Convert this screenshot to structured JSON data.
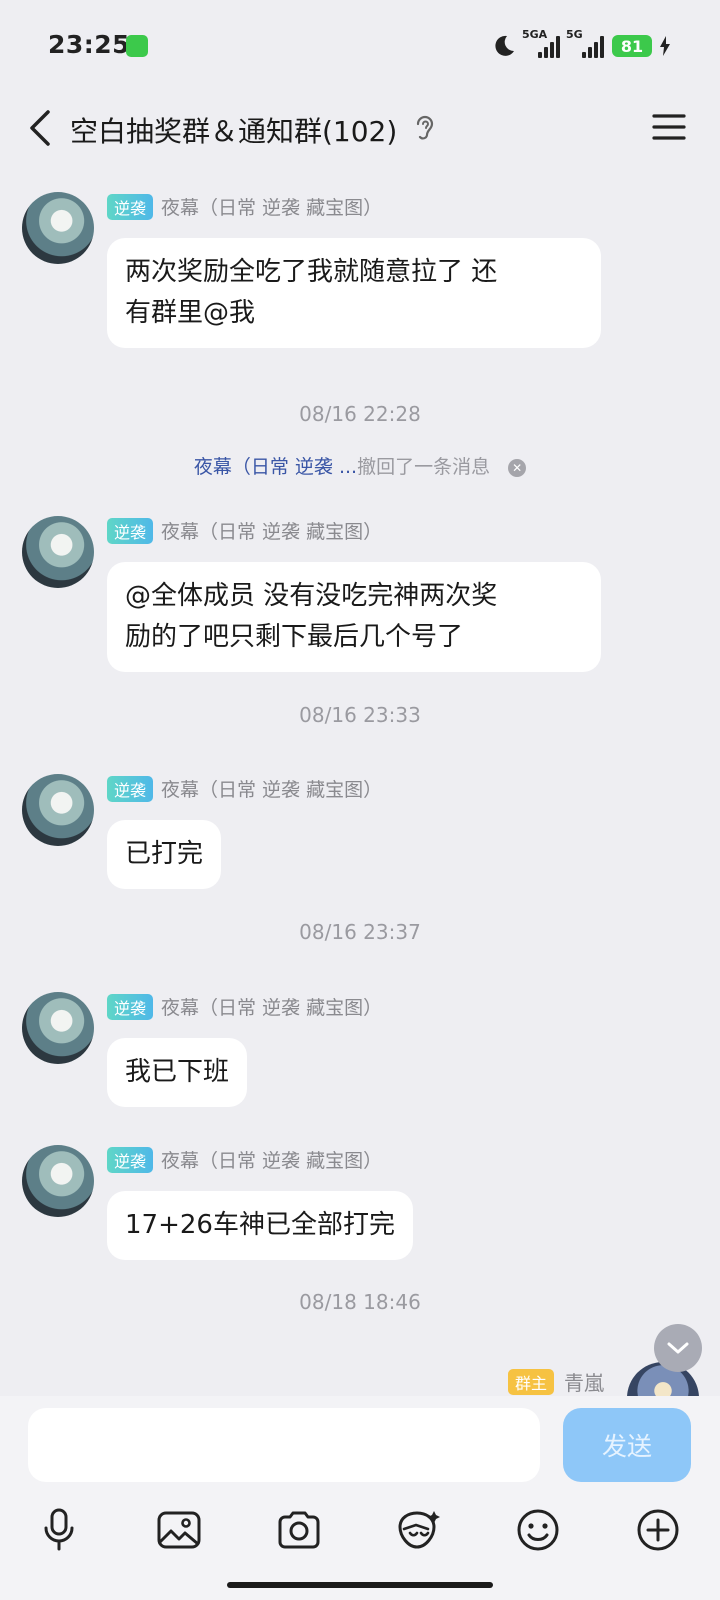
{
  "status_bar": {
    "time": "23:25",
    "network1": "5GA",
    "network2": "5G",
    "battery": "81"
  },
  "header": {
    "title": "空白抽奖群＆通知群(102)"
  },
  "chat": {
    "messages": [
      {
        "badge": "逆袭",
        "sender": "夜幕（日常 逆袭 藏宝图）",
        "text": [
          "两次奖励全吃了我就随意拉了 还",
          "有群里@我"
        ]
      },
      {
        "badge": "逆袭",
        "sender": "夜幕（日常 逆袭 藏宝图）",
        "text": [
          "@全体成员 没有没吃完神两次奖",
          "励的了吧只剩下最后几个号了"
        ]
      },
      {
        "badge": "逆袭",
        "sender": "夜幕（日常 逆袭 藏宝图）",
        "text": [
          "已打完"
        ]
      },
      {
        "badge": "逆袭",
        "sender": "夜幕（日常 逆袭 藏宝图）",
        "text": [
          "我已下班"
        ]
      },
      {
        "badge": "逆袭",
        "sender": "夜幕（日常 逆袭 藏宝图）",
        "text": [
          "17+26车神已全部打完"
        ]
      }
    ],
    "timestamps": [
      "08/16 22:28",
      "08/16 23:33",
      "08/16 23:37",
      "08/18 18:46"
    ],
    "recall": {
      "who": "夜幕（日常 逆袭 ...",
      "text": "撤回了一条消息"
    },
    "owner": {
      "badge": "群主",
      "name": "青嵐"
    }
  },
  "input": {
    "value": "",
    "send_label": "发送"
  },
  "toolbar": [
    "microphone-icon",
    "image-icon",
    "camera-icon",
    "red-packet-icon",
    "emoji-icon",
    "plus-icon"
  ]
}
